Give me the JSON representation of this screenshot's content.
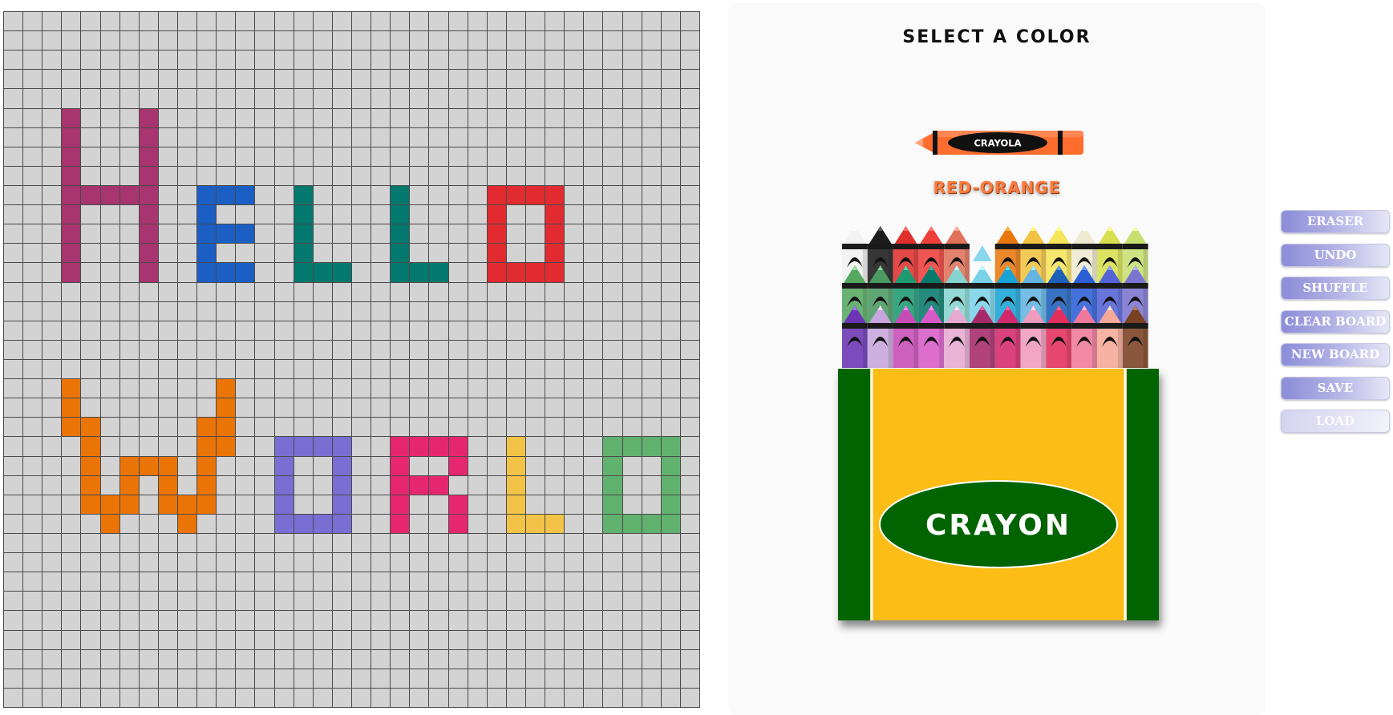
{
  "board": {
    "rows": 36,
    "cols": 36,
    "empty_color": "#d3d3d3",
    "grid_line_color": "#4a4a4a",
    "filled_cells": [
      {
        "color": "#a8356f",
        "rows": [
          5,
          6,
          7,
          8,
          9,
          10,
          11,
          12,
          13
        ],
        "cols": [
          3,
          7
        ]
      },
      {
        "color": "#a8356f",
        "rows": [
          9
        ],
        "cols": [
          4,
          5,
          6
        ]
      },
      {
        "color": "#1b5fc4",
        "rows": [
          9,
          10,
          11,
          12,
          13
        ],
        "cols": [
          10
        ]
      },
      {
        "color": "#1b5fc4",
        "rows": [
          9,
          11,
          13
        ],
        "cols": [
          11,
          12
        ]
      },
      {
        "color": "#03786f",
        "rows": [
          9,
          10,
          11,
          12,
          13
        ],
        "cols": [
          15
        ]
      },
      {
        "color": "#03786f",
        "rows": [
          13
        ],
        "cols": [
          16,
          17
        ]
      },
      {
        "color": "#03786f",
        "rows": [
          9,
          10,
          11,
          12,
          13
        ],
        "cols": [
          20
        ]
      },
      {
        "color": "#03786f",
        "rows": [
          13
        ],
        "cols": [
          21,
          22
        ]
      },
      {
        "color": "#e12b30",
        "rows": [
          9,
          10,
          11,
          12,
          13
        ],
        "cols": [
          25,
          28
        ]
      },
      {
        "color": "#e12b30",
        "rows": [
          9,
          13
        ],
        "cols": [
          26,
          27
        ]
      },
      {
        "color": "#ea7405",
        "rows": [
          19,
          20,
          21
        ],
        "cols": [
          3
        ]
      },
      {
        "color": "#ea7405",
        "rows": [
          21,
          22,
          23,
          24,
          25
        ],
        "cols": [
          4
        ]
      },
      {
        "color": "#ea7405",
        "rows": [
          25,
          26
        ],
        "cols": [
          5
        ]
      },
      {
        "color": "#ea7405",
        "rows": [
          23,
          24,
          25
        ],
        "cols": [
          6
        ]
      },
      {
        "color": "#ea7405",
        "rows": [
          23
        ],
        "cols": [
          7
        ]
      },
      {
        "color": "#ea7405",
        "rows": [
          23,
          24,
          25
        ],
        "cols": [
          8
        ]
      },
      {
        "color": "#ea7405",
        "rows": [
          25,
          26
        ],
        "cols": [
          9
        ]
      },
      {
        "color": "#ea7405",
        "rows": [
          21,
          22,
          23,
          24,
          25
        ],
        "cols": [
          10
        ]
      },
      {
        "color": "#ea7405",
        "rows": [
          19,
          20,
          21,
          22
        ],
        "cols": [
          11
        ]
      },
      {
        "color": "#7b6ed2",
        "rows": [
          22,
          23,
          24,
          25,
          26
        ],
        "cols": [
          14,
          17
        ]
      },
      {
        "color": "#7b6ed2",
        "rows": [
          22,
          26
        ],
        "cols": [
          15,
          16
        ]
      },
      {
        "color": "#e6276f",
        "rows": [
          22,
          23,
          24,
          25,
          26
        ],
        "cols": [
          20
        ]
      },
      {
        "color": "#e6276f",
        "rows": [
          22,
          24
        ],
        "cols": [
          21,
          22
        ]
      },
      {
        "color": "#e6276f",
        "rows": [
          22,
          23
        ],
        "cols": [
          23
        ]
      },
      {
        "color": "#e6276f",
        "rows": [
          25,
          26
        ],
        "cols": [
          23
        ]
      },
      {
        "color": "#f2c346",
        "rows": [
          22,
          23,
          24,
          25,
          26
        ],
        "cols": [
          26
        ]
      },
      {
        "color": "#f2c346",
        "rows": [
          26
        ],
        "cols": [
          27,
          28
        ]
      },
      {
        "color": "#62b26f",
        "rows": [
          22,
          23,
          24,
          25,
          26
        ],
        "cols": [
          31,
          34
        ]
      },
      {
        "color": "#62b26f",
        "rows": [
          22,
          26
        ],
        "cols": [
          32,
          33
        ]
      }
    ]
  },
  "panel": {
    "title": "SELECT A COLOR",
    "selected_color_name": "RED-ORANGE",
    "selected_color": "#ff6d2e",
    "selected_crayon_label": "CRAYOLA",
    "box_label": "CRAYON",
    "box_colors": {
      "body": "#fbbd13",
      "side": "#006400",
      "oval": "#006400"
    },
    "crayon_rows": [
      [
        "#f2f2f2",
        "#1c1c1c",
        "#e0302e",
        "#ee3e3a",
        "#e0715a",
        null,
        "#e8780e",
        "#f2c240",
        "#f6e45a",
        "#ecead0",
        "#d6e04e",
        "#c8e070"
      ],
      [
        "#55a860",
        "#4a9a62",
        "#1e9a72",
        "#077a6c",
        "#86d4d0",
        "#7ad2e8",
        "#18a4d6",
        "#64b4e2",
        "#1d5fba",
        "#2c5ed6",
        "#5464d6",
        "#7c74d0"
      ],
      [
        "#6a34b4",
        "#c6a6dc",
        "#c84cb8",
        "#d85ac8",
        "#e6aad0",
        "#a62a6a",
        "#d4286c",
        "#f09abc",
        "#e42e5c",
        "#f0789a",
        "#f8a898",
        "#7a4022"
      ]
    ],
    "missing_crayon_color": "#8ad6ec"
  },
  "controls": {
    "eraser": "ERASER",
    "undo": "UNDO",
    "shuffle": "SHUFFLE",
    "clear_board": "CLEAR BOARD",
    "new_board": "NEW BOARD",
    "save": "SAVE",
    "load": "LOAD"
  }
}
